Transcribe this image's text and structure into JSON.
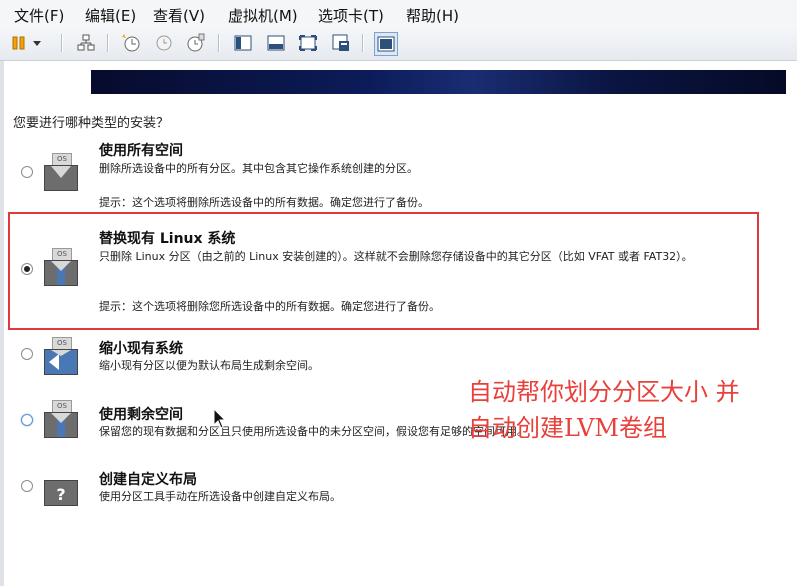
{
  "menu": [
    "文件(F)",
    "编辑(E)",
    "查看(V)",
    "虚拟机(M)",
    "选项卡(T)",
    "帮助(H)"
  ],
  "toolbar": [
    "pause-icon",
    "dropdown-icon",
    "network-icon",
    "snapshot-icon",
    "revert-icon",
    "snapshot-manager-icon",
    "console-view-icon",
    "fit-window-icon",
    "fullscreen-icon",
    "unity-icon",
    "thumbnail-icon"
  ],
  "installer": {
    "question": "您要进行哪种类型的安装？",
    "options": [
      {
        "title": "使用所有空间",
        "desc": "删除所选设备中的所有分区。其中包含其它操作系统创建的分区。",
        "note": "提示：这个选项将删除所选设备中的所有数据。确定您进行了备份。",
        "icon": "os-disk-erase-icon",
        "selected": false
      },
      {
        "title": "替换现有 Linux 系统",
        "desc": "只删除 Linux 分区（由之前的 Linux 安装创建的）。这样就不会删除您存储设备中的其它分区（比如 VFAT 或者 FAT32）。",
        "note": "提示：这个选项将删除您所选设备中的所有数据。确定您进行了备份。",
        "icon": "os-disk-replace-icon",
        "selected": true
      },
      {
        "title": "缩小现有系统",
        "desc": "缩小现有分区以便为默认布局生成剩余空间。",
        "note": "",
        "icon": "os-disk-shrink-icon",
        "selected": false
      },
      {
        "title": "使用剩余空间",
        "desc": "保留您的现有数据和分区且只使用所选设备中的未分区空间，假设您有足够的空间可用。",
        "note": "",
        "icon": "os-disk-free-space-icon",
        "selected": false
      },
      {
        "title": "创建自定义布局",
        "desc": "使用分区工具手动在所选设备中创建自定义布局。",
        "note": "",
        "icon": "custom-layout-icon",
        "selected": false
      }
    ]
  },
  "annotation": {
    "line1": "自动帮你划分分区大小 并",
    "line2": "自动创建LVM卷组",
    "color": "#e8403a"
  },
  "highlight_color": "#e0393d"
}
